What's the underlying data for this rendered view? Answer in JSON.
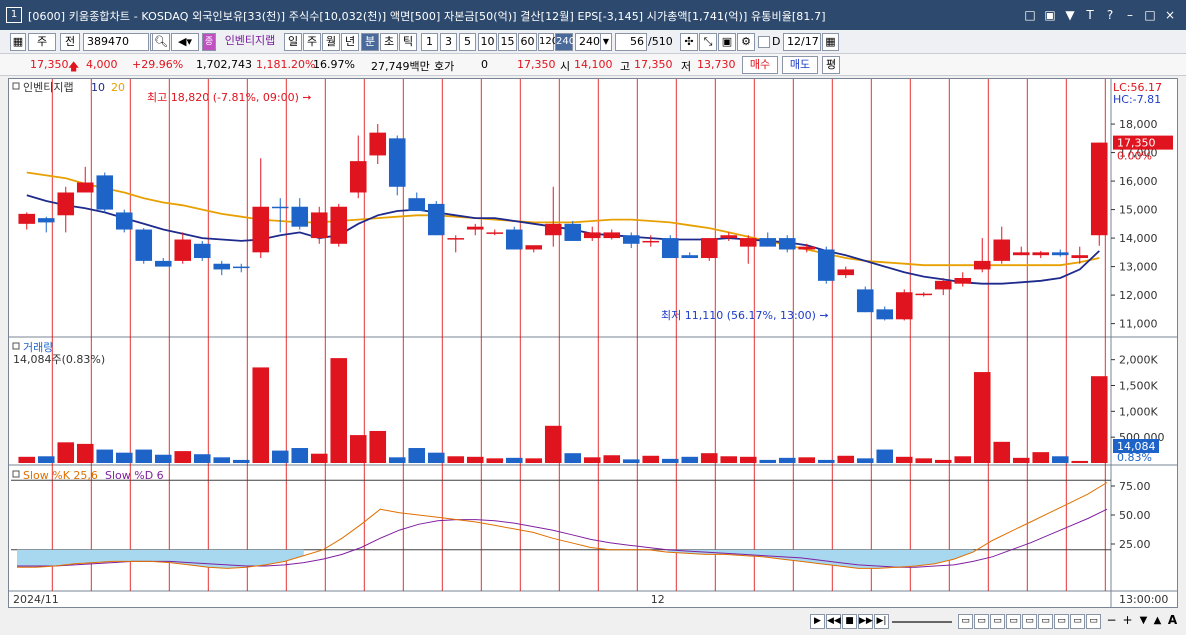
{
  "window": {
    "number": "1",
    "title": "[0600] 키움종합차트 - KOSDAQ 외국인보유[33(천)] 주식수[10,032(천)] 액면[500] 자본금[50(억)] 결산[12월] EPS[-3,145] 시가총액[1,741(억)] 유통비율[81.7]",
    "icons": [
      "□",
      "▣",
      "▼",
      "T",
      "?",
      "–",
      "□",
      "×"
    ]
  },
  "toolbar": {
    "type1": "주",
    "type2": "전",
    "code": "389470",
    "stock_name": "인벤티지랩",
    "periods": [
      "일",
      "주",
      "월",
      "년",
      "분",
      "초",
      "틱"
    ],
    "minutes": [
      "1",
      "3",
      "5",
      "10",
      "15",
      "60",
      "120",
      "240"
    ],
    "selected_minute": "240",
    "minute_select": "240",
    "count": "56",
    "count_total": "/510",
    "date_label": "D",
    "date": "12/17"
  },
  "quote": {
    "price": "17,350",
    "change": "4,000",
    "change_pct": "+29.96%",
    "volume": "1,702,743",
    "volume_ratio": "1,181.20%",
    "turnover": "16.97%",
    "amount": "27,749백만",
    "hoga_label": "호가",
    "hoga": "0",
    "hoga_price": "17,350",
    "open_label": "시",
    "open": "14,100",
    "high_label": "고",
    "high": "17,350",
    "low_label": "저",
    "low": "13,730",
    "buy": "매수",
    "sell": "매도",
    "eval": "평"
  },
  "price_panel": {
    "legend_name": "인벤티지랩",
    "ma1": "10",
    "ma2": "20",
    "high_annotation": "최고 18,820 (-7.81%, 09:00)",
    "low_annotation": "최저 11,110 (56.17%, 13:00)",
    "lc": "LC:56.17",
    "hc": "HC:-7.81",
    "current_price": "17,350",
    "current_pct": "0.00%",
    "y_ticks": [
      "18,000",
      "17,000",
      "16,000",
      "15,000",
      "14,000",
      "13,000",
      "12,000",
      "11,000"
    ]
  },
  "volume_panel": {
    "title": "거래량",
    "current": "14,084주(0.83%)",
    "y_ticks": [
      "2,000K",
      "1,500K",
      "1,000K",
      "500,000"
    ],
    "current_tag": "14,084",
    "current_pct": "0.83%"
  },
  "stoch_panel": {
    "k_label": "Slow %K 25,6",
    "d_label": "Slow %D 6",
    "y_ticks": [
      "75.00",
      "50.00",
      "25.00"
    ]
  },
  "x_axis": {
    "labels": [
      "2024/11",
      "12"
    ],
    "time": "13:00:00"
  },
  "colors": {
    "up": "#e0141e",
    "down": "#1e64c8",
    "ma10": "#1e2a8c",
    "ma20": "#e8a000",
    "stoch_k": "#e07000",
    "stoch_d": "#8020a0",
    "fill": "#a8d8f0",
    "grid_red": "#e00000"
  },
  "chart_data": {
    "type": "candlestick",
    "interval": "240min",
    "candles": [
      {
        "o": 14500,
        "h": 14900,
        "l": 14300,
        "c": 14850
      },
      {
        "o": 14700,
        "h": 14750,
        "l": 14200,
        "c": 14550
      },
      {
        "o": 14800,
        "h": 15800,
        "l": 14200,
        "c": 15600
      },
      {
        "o": 15600,
        "h": 16500,
        "l": 15600,
        "c": 15950
      },
      {
        "o": 16200,
        "h": 16300,
        "l": 14900,
        "c": 15000
      },
      {
        "o": 14900,
        "h": 15000,
        "l": 14200,
        "c": 14300
      },
      {
        "o": 14300,
        "h": 14350,
        "l": 13100,
        "c": 13200
      },
      {
        "o": 13200,
        "h": 13300,
        "l": 13000,
        "c": 13000
      },
      {
        "o": 13200,
        "h": 14200,
        "l": 13100,
        "c": 13950
      },
      {
        "o": 13800,
        "h": 13900,
        "l": 13200,
        "c": 13300
      },
      {
        "o": 13100,
        "h": 13200,
        "l": 12700,
        "c": 12900
      },
      {
        "o": 13000,
        "h": 13100,
        "l": 12800,
        "c": 12950
      },
      {
        "o": 13500,
        "h": 16800,
        "l": 13300,
        "c": 15100
      },
      {
        "o": 15100,
        "h": 15400,
        "l": 14200,
        "c": 15050
      },
      {
        "o": 15100,
        "h": 15400,
        "l": 14300,
        "c": 14400
      },
      {
        "o": 14000,
        "h": 15100,
        "l": 13800,
        "c": 14900
      },
      {
        "o": 13800,
        "h": 15200,
        "l": 13700,
        "c": 15100
      },
      {
        "o": 15600,
        "h": 17600,
        "l": 15400,
        "c": 16700
      },
      {
        "o": 16900,
        "h": 18000,
        "l": 16600,
        "c": 17700
      },
      {
        "o": 17500,
        "h": 17600,
        "l": 15500,
        "c": 15800
      },
      {
        "o": 15400,
        "h": 15600,
        "l": 15000,
        "c": 14950
      },
      {
        "o": 15200,
        "h": 15300,
        "l": 14100,
        "c": 14100
      },
      {
        "o": 14000,
        "h": 14100,
        "l": 13500,
        "c": 14000
      },
      {
        "o": 14300,
        "h": 14500,
        "l": 14100,
        "c": 14400
      },
      {
        "o": 14200,
        "h": 14300,
        "l": 14100,
        "c": 14200
      },
      {
        "o": 14300,
        "h": 14400,
        "l": 13800,
        "c": 13600
      },
      {
        "o": 13600,
        "h": 13700,
        "l": 13500,
        "c": 13750
      },
      {
        "o": 14100,
        "h": 15800,
        "l": 13700,
        "c": 14500
      },
      {
        "o": 14500,
        "h": 14600,
        "l": 13900,
        "c": 13900
      },
      {
        "o": 14000,
        "h": 14400,
        "l": 13900,
        "c": 14200
      },
      {
        "o": 14000,
        "h": 14300,
        "l": 13950,
        "c": 14200
      },
      {
        "o": 14100,
        "h": 14200,
        "l": 13650,
        "c": 13800
      },
      {
        "o": 13900,
        "h": 14100,
        "l": 13700,
        "c": 13900
      },
      {
        "o": 14000,
        "h": 14100,
        "l": 13300,
        "c": 13300
      },
      {
        "o": 13400,
        "h": 13500,
        "l": 13300,
        "c": 13300
      },
      {
        "o": 13300,
        "h": 14000,
        "l": 13200,
        "c": 14000
      },
      {
        "o": 14000,
        "h": 14200,
        "l": 13900,
        "c": 14100
      },
      {
        "o": 13700,
        "h": 14100,
        "l": 13100,
        "c": 14000
      },
      {
        "o": 14000,
        "h": 14200,
        "l": 13700,
        "c": 13700
      },
      {
        "o": 14000,
        "h": 14100,
        "l": 13500,
        "c": 13600
      },
      {
        "o": 13600,
        "h": 13800,
        "l": 13500,
        "c": 13700
      },
      {
        "o": 13600,
        "h": 13700,
        "l": 12400,
        "c": 12500
      },
      {
        "o": 12700,
        "h": 13000,
        "l": 12600,
        "c": 12900
      },
      {
        "o": 12200,
        "h": 12300,
        "l": 11400,
        "c": 11400
      },
      {
        "o": 11500,
        "h": 11600,
        "l": 11110,
        "c": 11150
      },
      {
        "o": 11150,
        "h": 12200,
        "l": 11110,
        "c": 12100
      },
      {
        "o": 12000,
        "h": 12100,
        "l": 11950,
        "c": 12050
      },
      {
        "o": 12200,
        "h": 12600,
        "l": 12000,
        "c": 12500
      },
      {
        "o": 12400,
        "h": 12800,
        "l": 12300,
        "c": 12600
      },
      {
        "o": 12900,
        "h": 14000,
        "l": 12800,
        "c": 13200
      },
      {
        "o": 13200,
        "h": 14400,
        "l": 13100,
        "c": 13950
      },
      {
        "o": 13400,
        "h": 13700,
        "l": 13400,
        "c": 13500
      },
      {
        "o": 13400,
        "h": 13550,
        "l": 13300,
        "c": 13500
      },
      {
        "o": 13500,
        "h": 13600,
        "l": 13350,
        "c": 13400
      },
      {
        "o": 13300,
        "h": 13700,
        "l": 13100,
        "c": 13400
      },
      {
        "o": 14100,
        "h": 17350,
        "l": 13730,
        "c": 17350
      }
    ],
    "volumes": [
      120,
      130,
      400,
      370,
      260,
      200,
      260,
      160,
      230,
      170,
      110,
      60,
      1850,
      240,
      290,
      180,
      2030,
      540,
      620,
      110,
      290,
      200,
      130,
      120,
      90,
      100,
      90,
      720,
      190,
      110,
      150,
      70,
      140,
      80,
      120,
      190,
      130,
      120,
      60,
      100,
      110,
      60,
      140,
      90,
      260,
      120,
      90,
      60,
      130,
      1760,
      410,
      100,
      210,
      130,
      40,
      1680
    ],
    "ma10": [
      15500,
      15300,
      15150,
      15050,
      14900,
      14700,
      14500,
      14300,
      14150,
      14000,
      13950,
      13900,
      13950,
      14100,
      14200,
      14000,
      14100,
      14500,
      14800,
      14950,
      15000,
      14900,
      14800,
      14700,
      14700,
      14600,
      14500,
      14400,
      14300,
      14150,
      14100,
      14050,
      14000,
      13950,
      13950,
      13950,
      14000,
      13950,
      13900,
      13850,
      13750,
      13550,
      13400,
      13200,
      13000,
      12800,
      12650,
      12550,
      12450,
      12400,
      12400,
      12450,
      12500,
      12600,
      12900,
      13550
    ],
    "ma20": [
      16300,
      16200,
      16100,
      15900,
      15750,
      15600,
      15400,
      15250,
      15150,
      15000,
      14850,
      14750,
      14650,
      14600,
      14550,
      14550,
      14600,
      14650,
      14700,
      14750,
      14800,
      14800,
      14750,
      14700,
      14650,
      14600,
      14550,
      14550,
      14550,
      14600,
      14650,
      14650,
      14600,
      14550,
      14450,
      14350,
      14200,
      14050,
      13900,
      13750,
      13600,
      13450,
      13300,
      13200,
      13150,
      13100,
      13050,
      13050,
      13050,
      13050,
      13050,
      13050,
      13050,
      13050,
      13150,
      13300
    ],
    "stoch_k": [
      5,
      5,
      6,
      8,
      9,
      10,
      10,
      10,
      9,
      7,
      5,
      4,
      5,
      7,
      10,
      15,
      20,
      30,
      42,
      55,
      52,
      50,
      48,
      46,
      44,
      41,
      38,
      35,
      30,
      26,
      22,
      20,
      20,
      20,
      18,
      17,
      16,
      16,
      15,
      14,
      12,
      10,
      8,
      6,
      4,
      4,
      5,
      6,
      8,
      12,
      18,
      28,
      36,
      44,
      52,
      60,
      68,
      78
    ],
    "stoch_d": [
      6,
      6,
      6,
      7,
      8,
      9,
      10,
      10,
      10,
      9,
      8,
      7,
      6,
      6,
      7,
      9,
      12,
      16,
      22,
      30,
      37,
      42,
      45,
      46,
      46,
      45,
      43,
      40,
      37,
      33,
      29,
      26,
      24,
      22,
      20,
      19,
      18,
      17,
      16,
      15,
      14,
      13,
      11,
      9,
      7,
      6,
      5,
      5,
      6,
      7,
      10,
      14,
      20,
      26,
      33,
      40,
      47,
      55
    ]
  }
}
